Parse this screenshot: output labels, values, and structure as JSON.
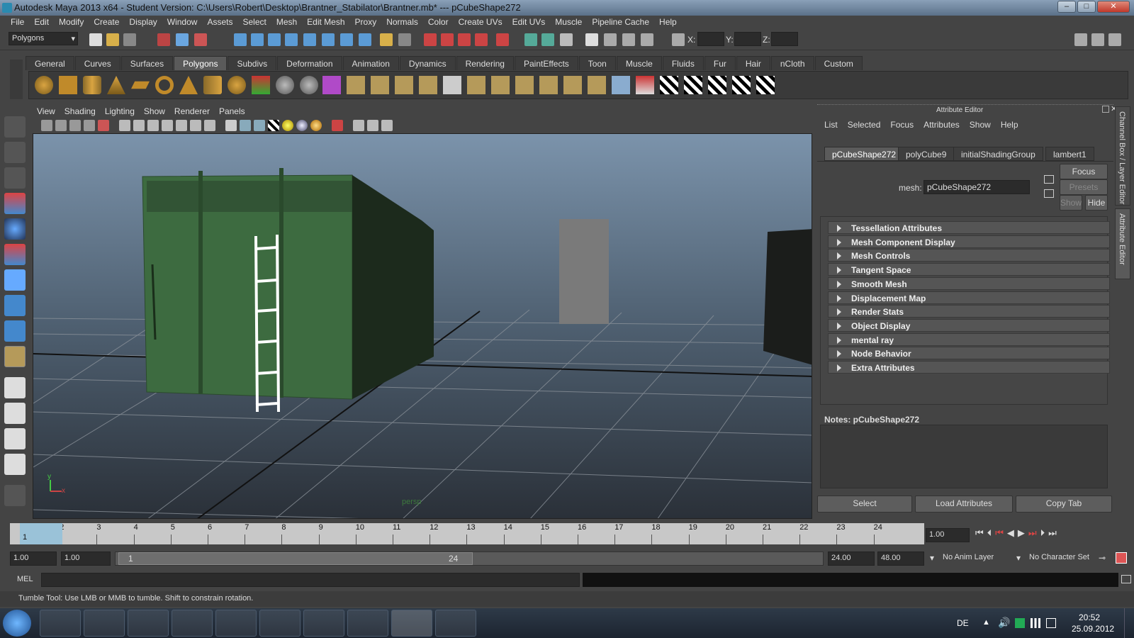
{
  "window": {
    "title": "Autodesk Maya 2013 x64 - Student Version: C:\\Users\\Robert\\Desktop\\Brantner_Stabilator\\Brantner.mb*  ---  pCubeShape272",
    "min": "–",
    "max": "□",
    "close": "✕"
  },
  "menubar": [
    "File",
    "Edit",
    "Modify",
    "Create",
    "Display",
    "Window",
    "Assets",
    "Select",
    "Mesh",
    "Edit Mesh",
    "Proxy",
    "Normals",
    "Color",
    "Create UVs",
    "Edit UVs",
    "Muscle",
    "Pipeline Cache",
    "Help"
  ],
  "statusline": {
    "mode": "Polygons",
    "x_label": "X:",
    "y_label": "Y:",
    "z_label": "Z:"
  },
  "shelf_tabs": [
    "General",
    "Curves",
    "Surfaces",
    "Polygons",
    "Subdivs",
    "Deformation",
    "Animation",
    "Dynamics",
    "Rendering",
    "PaintEffects",
    "Toon",
    "Muscle",
    "Fluids",
    "Fur",
    "Hair",
    "nCloth",
    "Custom"
  ],
  "shelf_active": "Polygons",
  "viewport": {
    "menu": [
      "View",
      "Shading",
      "Lighting",
      "Show",
      "Renderer",
      "Panels"
    ],
    "camera_label": "persp",
    "axis_y": "y",
    "axis_x": "x"
  },
  "attribute_editor": {
    "title": "Attribute Editor",
    "menu": [
      "List",
      "Selected",
      "Focus",
      "Attributes",
      "Show",
      "Help"
    ],
    "tabs": [
      "pCubeShape272",
      "polyCube9",
      "initialShadingGroup",
      "lambert1"
    ],
    "mesh_label": "mesh:",
    "mesh_value": "pCubeShape272",
    "focus_btn": "Focus",
    "presets_btn": "Presets",
    "show_btn": "Show",
    "hide_btn": "Hide",
    "sections": [
      "Tessellation Attributes",
      "Mesh Component Display",
      "Mesh Controls",
      "Tangent Space",
      "Smooth Mesh",
      "Displacement Map",
      "Render Stats",
      "Object Display",
      "mental ray",
      "Node Behavior",
      "Extra Attributes"
    ],
    "notes_label": "Notes:  pCubeShape272",
    "select_btn": "Select",
    "load_btn": "Load Attributes",
    "copy_btn": "Copy Tab",
    "side_tab1": "Channel Box / Layer Editor",
    "side_tab2": "Attribute Editor"
  },
  "timeline": {
    "ticks": [
      "1",
      "2",
      "3",
      "4",
      "5",
      "6",
      "7",
      "8",
      "9",
      "10",
      "11",
      "12",
      "13",
      "14",
      "15",
      "16",
      "17",
      "18",
      "19",
      "20",
      "21",
      "22",
      "23",
      "24"
    ],
    "current": "1",
    "current_field": "1.00"
  },
  "range": {
    "start": "1.00",
    "inner_start": "1.00",
    "slider_start": "1",
    "slider_end": "24",
    "end": "24.00",
    "outer_end": "48.00",
    "anim_layer": "No Anim Layer",
    "char_set": "No Character Set"
  },
  "cmdline": {
    "label": "MEL"
  },
  "helpline": "Tumble Tool: Use LMB or MMB to tumble. Shift to constrain rotation.",
  "taskbar": {
    "lang": "DE",
    "time": "20:52",
    "date": "25.09.2012"
  }
}
